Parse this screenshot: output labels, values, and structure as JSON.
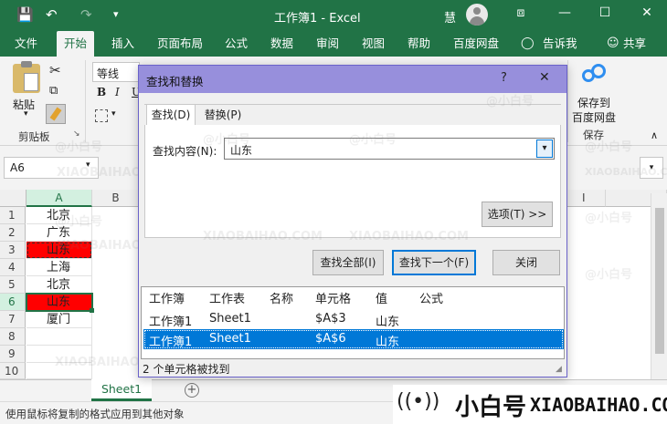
{
  "window": {
    "title": "工作簿1 - Excel",
    "user": "慧",
    "qat": {
      "save_glyph": "💾",
      "undo_glyph": "↶",
      "redo_glyph": "↷",
      "more_glyph": "▾"
    },
    "controls": {
      "ribbon_glyph": "⧈",
      "min_glyph": "—",
      "max_glyph": "☐",
      "close_glyph": "✕"
    }
  },
  "ribbon": {
    "tabs": [
      "文件",
      "开始",
      "插入",
      "页面布局",
      "公式",
      "数据",
      "审阅",
      "视图",
      "帮助",
      "百度网盘",
      "告诉我",
      "共享"
    ],
    "active_tab": "开始",
    "clipboard": {
      "paste": "粘贴",
      "group": "剪贴板"
    },
    "font": {
      "name": "等线",
      "bold": "B",
      "italic": "I",
      "underline": "U"
    },
    "baidu": {
      "save_line1": "保存到",
      "save_line2": "百度网盘",
      "group": "保存"
    }
  },
  "namebox": {
    "value": "A6"
  },
  "grid": {
    "columns": [
      "A",
      "B",
      "I"
    ],
    "rows": [
      "1",
      "2",
      "3",
      "4",
      "5",
      "6",
      "7",
      "8",
      "9",
      "10"
    ],
    "cells": [
      "北京",
      "广东",
      "山东",
      "上海",
      "北京",
      "山东",
      "厦门",
      "",
      "",
      ""
    ],
    "highlight_color": "#ff0000"
  },
  "sheettabs": {
    "sheet1": "Sheet1",
    "add": "+"
  },
  "statusbar": {
    "message": "使用鼠标将复制的格式应用到其他对象"
  },
  "dialog": {
    "title": "查找和替换",
    "help": "?",
    "close": "✕",
    "tabs": [
      "查找(D)",
      "替换(P)"
    ],
    "find_label": "查找内容(N):",
    "find_value": "山东",
    "options_button": "选项(T) >>",
    "find_all_button": "查找全部(I)",
    "find_next_button": "查找下一个(F)",
    "close_button": "关闭",
    "results": {
      "headers": [
        "工作簿",
        "工作表",
        "名称",
        "单元格",
        "值",
        "公式"
      ],
      "rows": [
        [
          "工作簿1",
          "Sheet1",
          "",
          "$A$3",
          "山东",
          ""
        ],
        [
          "工作簿1",
          "Sheet1",
          "",
          "$A$6",
          "山东",
          ""
        ]
      ]
    },
    "status": "2 个单元格被找到"
  },
  "watermark": {
    "text": "@小白号",
    "url": "XIAOBAIHAO.COM",
    "brand": "小白号",
    "brand_url": "XIAOBAIHAO.COM"
  },
  "colors": {
    "excel_green": "#217346",
    "dialog_title": "#978fdc",
    "selection_blue": "#0078d7"
  }
}
